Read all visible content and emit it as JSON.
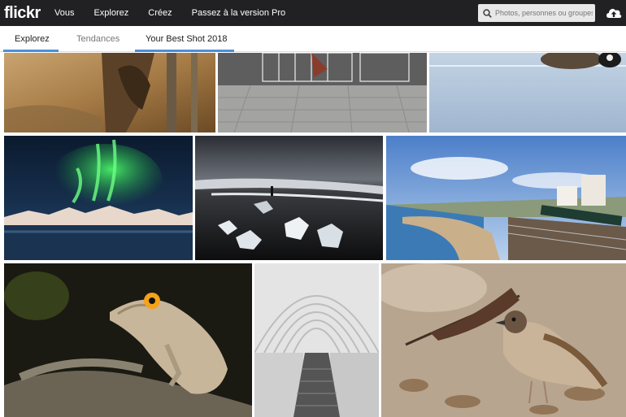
{
  "header": {
    "logo": "flickr",
    "nav": [
      "Vous",
      "Explorez",
      "Créez",
      "Passez à la version Pro"
    ],
    "search_placeholder": "Photos, personnes ou groupes"
  },
  "tabs": [
    "Explorez",
    "Tendances",
    "Your Best Shot 2018"
  ],
  "icons": {
    "search": "search-icon",
    "upload": "upload-cloud-icon"
  }
}
